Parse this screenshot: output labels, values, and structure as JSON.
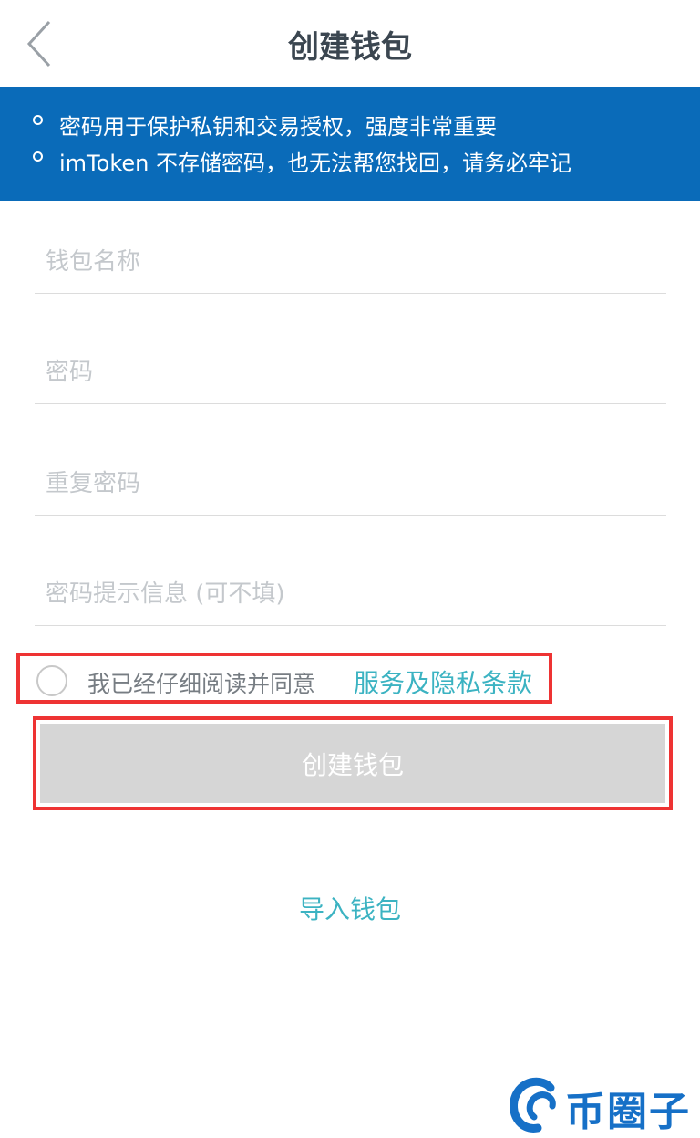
{
  "navbar": {
    "title": "创建钱包",
    "back_icon": "chevron-left-icon"
  },
  "banner": {
    "items": [
      "密码用于保护私钥和交易授权，强度非常重要",
      "imToken 不存储密码，也无法帮您找回，请务必牢记"
    ]
  },
  "form": {
    "wallet_name_placeholder": "钱包名称",
    "password_placeholder": "密码",
    "repeat_password_placeholder": "重复密码",
    "hint_placeholder": "密码提示信息 (可不填)"
  },
  "agreement": {
    "text": "我已经仔细阅读并同意",
    "link": "服务及隐私条款",
    "checked": false
  },
  "create_button": "创建钱包",
  "import_link": "导入钱包",
  "watermark": {
    "text": "币圈子",
    "color": "#1670c7"
  },
  "colors": {
    "banner_bg": "#0a6bb9",
    "accent": "#3cb3c2",
    "highlight_border": "#ee3333",
    "disabled_button": "#d6d6d6"
  }
}
